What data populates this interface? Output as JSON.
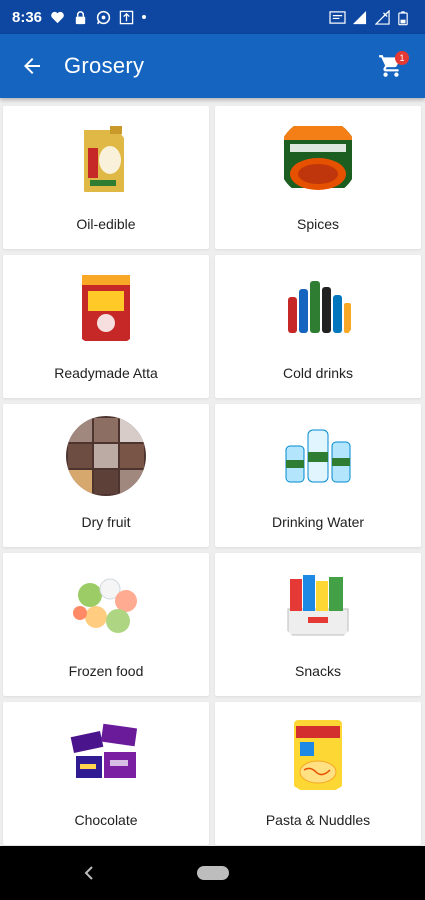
{
  "status_bar": {
    "time": "8:36",
    "icons": [
      "heart-icon",
      "lock-icon",
      "whatsapp-icon",
      "usb-icon",
      "notification-dot",
      "wifi-calling-icon",
      "signal-icon",
      "signal-x-icon",
      "battery-icon"
    ]
  },
  "app_bar": {
    "title": "Grosery",
    "back_icon": "arrow-back-icon",
    "cart_icon": "shopping-cart-icon",
    "cart_count": "1",
    "color": "#1565c0"
  },
  "categories": [
    {
      "label": "Oil-edible",
      "icon": "oil-can-image"
    },
    {
      "label": "Spices",
      "icon": "spice-pack-image"
    },
    {
      "label": "Readymade Atta",
      "icon": "atta-bag-image"
    },
    {
      "label": "Cold drinks",
      "icon": "bottles-image"
    },
    {
      "label": "Dry fruit",
      "icon": "dry-fruit-image"
    },
    {
      "label": "Drinking Water",
      "icon": "water-bottles-image"
    },
    {
      "label": "Frozen food",
      "icon": "frozen-veg-image"
    },
    {
      "label": "Snacks",
      "icon": "snacks-box-image"
    },
    {
      "label": "Chocolate",
      "icon": "chocolates-image"
    },
    {
      "label": "Pasta & Nuddles",
      "icon": "noodles-pack-image"
    }
  ],
  "nav_bar": {
    "back_icon": "nav-back-icon",
    "home_icon": "nav-home-pill"
  }
}
